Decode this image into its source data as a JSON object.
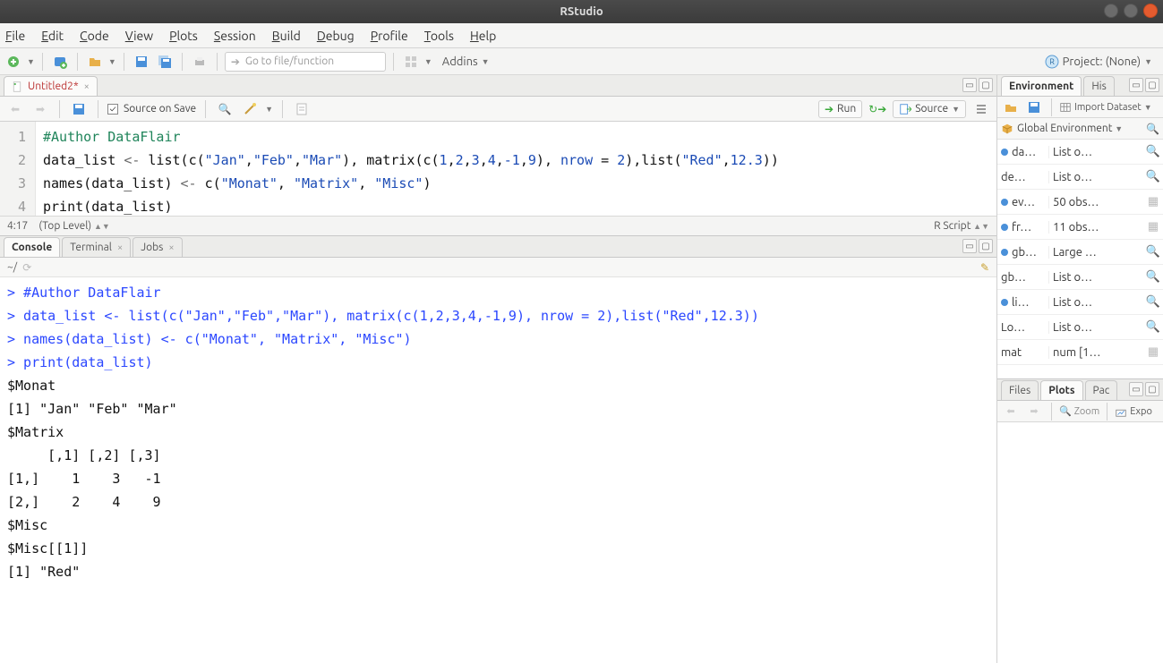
{
  "title": "RStudio",
  "menus": [
    "File",
    "Edit",
    "Code",
    "View",
    "Plots",
    "Session",
    "Build",
    "Debug",
    "Profile",
    "Tools",
    "Help"
  ],
  "main_toolbar": {
    "goto_placeholder": "Go to file/function",
    "addins_label": "Addins",
    "project_label": "Project: (None)"
  },
  "source": {
    "tab_label": "Untitled2*",
    "source_on_save": "Source on Save",
    "run_label": "Run",
    "source_label": "Source",
    "code_lines": [
      {
        "n": "1",
        "segments": [
          {
            "t": "#Author DataFlair",
            "c": "c-comment"
          }
        ]
      },
      {
        "n": "2",
        "segments": [
          {
            "t": "data_list ",
            "c": ""
          },
          {
            "t": "<-",
            "c": "c-op"
          },
          {
            "t": " list",
            "c": ""
          },
          {
            "t": "(",
            "c": ""
          },
          {
            "t": "c",
            "c": ""
          },
          {
            "t": "(",
            "c": ""
          },
          {
            "t": "\"Jan\"",
            "c": "c-str"
          },
          {
            "t": ",",
            "c": ""
          },
          {
            "t": "\"Feb\"",
            "c": "c-str"
          },
          {
            "t": ",",
            "c": ""
          },
          {
            "t": "\"Mar\"",
            "c": "c-str"
          },
          {
            "t": ")",
            "c": ""
          },
          {
            "t": ", matrix",
            "c": ""
          },
          {
            "t": "(",
            "c": ""
          },
          {
            "t": "c",
            "c": ""
          },
          {
            "t": "(",
            "c": ""
          },
          {
            "t": "1",
            "c": "c-num"
          },
          {
            "t": ",",
            "c": ""
          },
          {
            "t": "2",
            "c": "c-num"
          },
          {
            "t": ",",
            "c": ""
          },
          {
            "t": "3",
            "c": "c-num"
          },
          {
            "t": ",",
            "c": ""
          },
          {
            "t": "4",
            "c": "c-num"
          },
          {
            "t": ",",
            "c": ""
          },
          {
            "t": "-1",
            "c": "c-num"
          },
          {
            "t": ",",
            "c": ""
          },
          {
            "t": "9",
            "c": "c-num"
          },
          {
            "t": ")",
            "c": ""
          },
          {
            "t": ", ",
            "c": ""
          },
          {
            "t": "nrow",
            "c": "c-arg"
          },
          {
            "t": " = ",
            "c": ""
          },
          {
            "t": "2",
            "c": "c-num"
          },
          {
            "t": ")",
            "c": ""
          },
          {
            "t": ",list",
            "c": ""
          },
          {
            "t": "(",
            "c": ""
          },
          {
            "t": "\"Red\"",
            "c": "c-str"
          },
          {
            "t": ",",
            "c": ""
          },
          {
            "t": "12.3",
            "c": "c-num"
          },
          {
            "t": ")",
            "c": ""
          },
          {
            "t": ")",
            "c": ""
          }
        ]
      },
      {
        "n": "3",
        "segments": [
          {
            "t": "names",
            "c": ""
          },
          {
            "t": "(",
            "c": ""
          },
          {
            "t": "data_list",
            "c": ""
          },
          {
            "t": ")",
            "c": ""
          },
          {
            "t": " ",
            "c": ""
          },
          {
            "t": "<-",
            "c": "c-op"
          },
          {
            "t": " c",
            "c": ""
          },
          {
            "t": "(",
            "c": ""
          },
          {
            "t": "\"Monat\"",
            "c": "c-str"
          },
          {
            "t": ", ",
            "c": ""
          },
          {
            "t": "\"Matrix\"",
            "c": "c-str"
          },
          {
            "t": ", ",
            "c": ""
          },
          {
            "t": "\"Misc\"",
            "c": "c-str"
          },
          {
            "t": ")",
            "c": ""
          }
        ]
      },
      {
        "n": "4",
        "segments": [
          {
            "t": "print",
            "c": ""
          },
          {
            "t": "(",
            "c": ""
          },
          {
            "t": "data_list",
            "c": ""
          },
          {
            "t": ")",
            "c": ""
          }
        ]
      }
    ],
    "status_left": "4:17",
    "status_scope": "(Top Level)",
    "status_right": "R Script"
  },
  "console": {
    "tabs": [
      "Console",
      "Terminal",
      "Jobs"
    ],
    "prompt_path": "~/",
    "lines": [
      {
        "t": "> #Author DataFlair",
        "c": "cons-cmd"
      },
      {
        "t": "> data_list <- list(c(\"Jan\",\"Feb\",\"Mar\"), matrix(c(1,2,3,4,-1,9), nrow = 2),list(\"Red\",12.3))",
        "c": "cons-cmd"
      },
      {
        "t": "> names(data_list) <- c(\"Monat\", \"Matrix\", \"Misc\")",
        "c": "cons-cmd"
      },
      {
        "t": "> print(data_list)",
        "c": "cons-cmd"
      },
      {
        "t": "$Monat",
        "c": "cons-out"
      },
      {
        "t": "[1] \"Jan\" \"Feb\" \"Mar\"",
        "c": "cons-out"
      },
      {
        "t": "",
        "c": "cons-out"
      },
      {
        "t": "$Matrix",
        "c": "cons-out"
      },
      {
        "t": "     [,1] [,2] [,3]",
        "c": "cons-out"
      },
      {
        "t": "[1,]    1    3   -1",
        "c": "cons-out"
      },
      {
        "t": "[2,]    2    4    9",
        "c": "cons-out"
      },
      {
        "t": "",
        "c": "cons-out"
      },
      {
        "t": "$Misc",
        "c": "cons-out"
      },
      {
        "t": "$Misc[[1]]",
        "c": "cons-out"
      },
      {
        "t": "[1] \"Red\"",
        "c": "cons-out"
      }
    ]
  },
  "env": {
    "tabs": [
      "Environment",
      "His"
    ],
    "import_label": "Import Dataset",
    "scope_label": "Global Environment",
    "rows": [
      {
        "dot": true,
        "name": "da…",
        "value": "List o…",
        "icon": "lens"
      },
      {
        "dot": false,
        "name": "de…",
        "value": "List o…",
        "icon": "lens"
      },
      {
        "dot": true,
        "name": "ev…",
        "value": "50 obs…",
        "icon": "grid"
      },
      {
        "dot": true,
        "name": "fr…",
        "value": "11 obs…",
        "icon": "grid"
      },
      {
        "dot": true,
        "name": "gb…",
        "value": "Large …",
        "icon": "lens"
      },
      {
        "dot": false,
        "name": "gb…",
        "value": "List o…",
        "icon": "lens"
      },
      {
        "dot": true,
        "name": "li…",
        "value": "List o…",
        "icon": "lens"
      },
      {
        "dot": false,
        "name": "Lo…",
        "value": "List o…",
        "icon": "lens"
      },
      {
        "dot": false,
        "name": "mat",
        "value": "num [1…",
        "icon": "grid"
      }
    ]
  },
  "plots": {
    "tabs": [
      "Files",
      "Plots",
      "Pac"
    ],
    "zoom_label": "Zoom",
    "export_label": "Expo"
  }
}
